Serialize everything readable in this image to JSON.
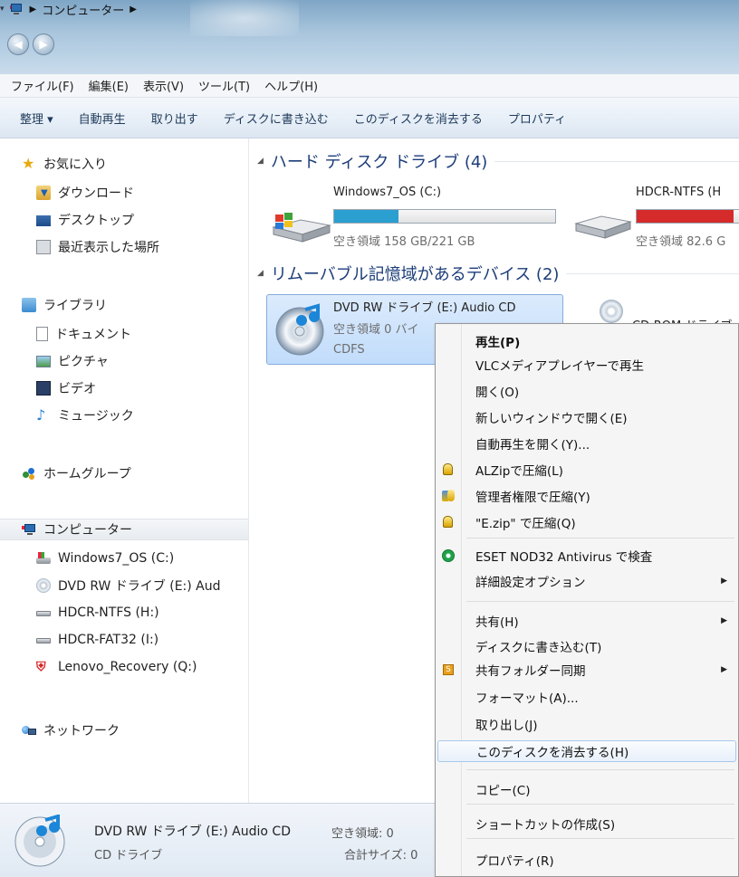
{
  "window": {
    "breadcrumb": [
      "コンピューター"
    ]
  },
  "menubar": [
    "ファイル(F)",
    "編集(E)",
    "表示(V)",
    "ツール(T)",
    "ヘルプ(H)"
  ],
  "commandbar": [
    "整理 ▾",
    "自動再生",
    "取り出す",
    "ディスクに書き込む",
    "このディスクを消去する",
    "プロパティ"
  ],
  "nav": {
    "favorites": {
      "label": "お気に入り",
      "items": [
        "ダウンロード",
        "デスクトップ",
        "最近表示した場所"
      ]
    },
    "libraries": {
      "label": "ライブラリ",
      "items": [
        "ドキュメント",
        "ピクチャ",
        "ビデオ",
        "ミュージック"
      ]
    },
    "homegroup": "ホームグループ",
    "computer": {
      "label": "コンピューター",
      "items": [
        "Windows7_OS (C:)",
        "DVD RW ドライブ (E:) Aud",
        "HDCR-NTFS (H:)",
        "HDCR-FAT32 (I:)",
        "Lenovo_Recovery (Q:)"
      ]
    },
    "network": "ネットワーク"
  },
  "content": {
    "hdd_group": "ハード ディスク ドライブ (4)",
    "removable_group": "リムーバブル記憶域があるデバイス (2)",
    "drives": [
      {
        "name": "Windows7_OS (C:)",
        "free": "空き領域 158 GB/221 GB",
        "used_fraction": 0.29,
        "bar_color": "#2a9fd0"
      },
      {
        "name": "HDCR-NTFS (H",
        "free": "空き領域 82.6 G",
        "used_fraction": 0.9,
        "bar_color": "#d62b2b"
      }
    ],
    "dvd": {
      "name": "DVD RW ドライブ (E:) Audio CD",
      "free": "空き領域 0 バイ",
      "fs": "CDFS"
    },
    "cd_partial": "CD-ROM ドライブ"
  },
  "details": {
    "name": "DVD RW ドライブ (E:) Audio CD",
    "type": "CD ドライブ",
    "free_label": "空き領域: 0",
    "total_label": "合計サイズ: 0"
  },
  "context_menu": {
    "items": [
      {
        "label": "再生(P)",
        "bold": true
      },
      {
        "label": "VLCメディアプレイヤーで再生"
      },
      {
        "label": "開く(O)"
      },
      {
        "label": "新しいウィンドウで開く(E)"
      },
      {
        "label": "自動再生を開く(Y)..."
      },
      {
        "label": "ALZipで圧縮(L)",
        "icon": "alzip-icon"
      },
      {
        "label": "管理者権限で圧縮(Y)",
        "icon": "alzip-admin-icon"
      },
      {
        "label": "\"E.zip\" で圧縮(Q)",
        "icon": "alzip-icon"
      },
      {
        "label": "ESET NOD32 Antivirus で検査",
        "icon": "eset-icon"
      },
      {
        "label": "詳細設定オプション",
        "submenu": true
      },
      {
        "label": "共有(H)",
        "submenu": true
      },
      {
        "label": "ディスクに書き込む(T)"
      },
      {
        "label": "共有フォルダー同期",
        "submenu": true,
        "icon": "sync-icon"
      },
      {
        "label": "フォーマット(A)..."
      },
      {
        "label": "取り出し(J)"
      },
      {
        "label": "このディスクを消去する(H)",
        "highlighted": true
      },
      {
        "label": "コピー(C)"
      },
      {
        "label": "ショートカットの作成(S)"
      },
      {
        "label": "プロパティ(R)"
      }
    ]
  }
}
